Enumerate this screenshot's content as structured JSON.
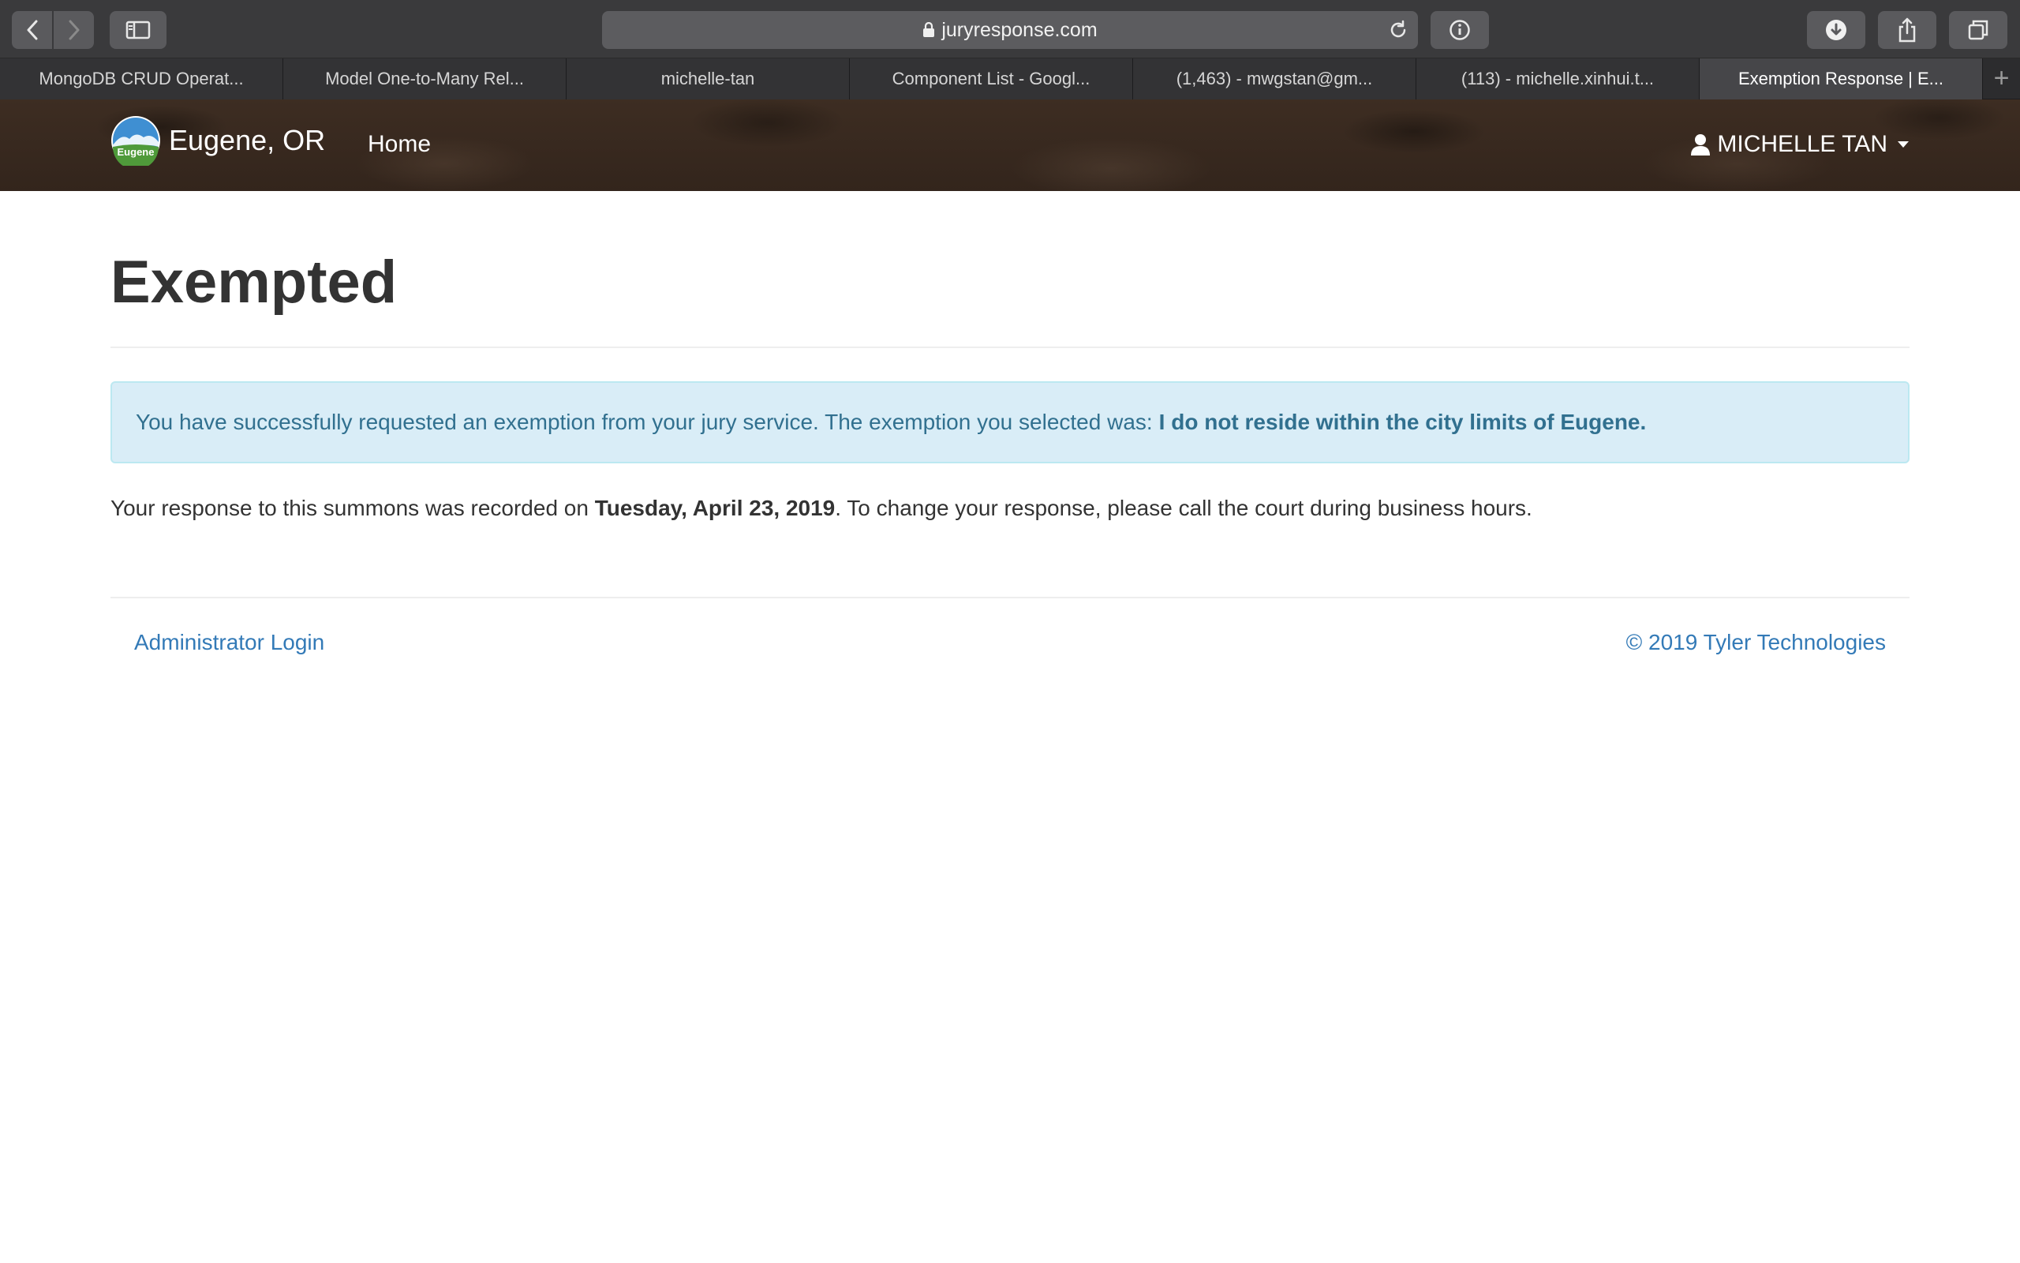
{
  "browser": {
    "url": "juryresponse.com",
    "tabs": [
      {
        "label": "MongoDB CRUD Operat..."
      },
      {
        "label": "Model One-to-Many Rel..."
      },
      {
        "label": "michelle-tan"
      },
      {
        "label": "Component List - Googl..."
      },
      {
        "label": "(1,463) - mwgstan@gm..."
      },
      {
        "label": "(113) - michelle.xinhui.t..."
      },
      {
        "label": "Exemption Response | E..."
      }
    ],
    "active_tab": 6,
    "new_tab_label": "+"
  },
  "navbar": {
    "logo_text": "Eugene",
    "brand": "Eugene, OR",
    "home": "Home",
    "user": "MICHELLE TAN"
  },
  "page": {
    "title": "Exempted",
    "alert_prefix": "You have successfully requested an exemption from your jury service. The exemption you selected was:",
    "alert_exemption": "I do not reside within the city limits of Eugene.",
    "summary_prefix": "Your response to this summons was recorded on",
    "summary_date": "Tuesday, April 23, 2019",
    "summary_suffix": ". To change your response, please call the court during business hours."
  },
  "footer": {
    "admin_login": "Administrator Login",
    "copyright": "© 2019 Tyler Technologies"
  },
  "colors": {
    "alert_bg": "#d9edf7",
    "alert_text": "#31708f",
    "link": "#337ab7",
    "navbar_bg": "#3a2a20"
  }
}
